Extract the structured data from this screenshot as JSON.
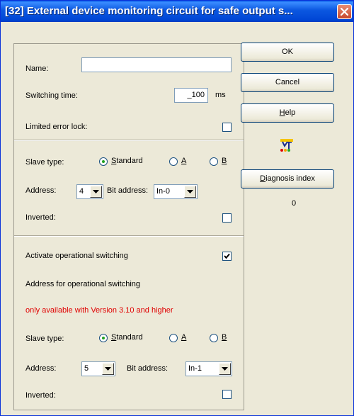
{
  "window": {
    "title": "[32] External device monitoring circuit for safe output s..."
  },
  "fields": {
    "name_label": "Name:",
    "name_value": "",
    "switching_time_label": "Switching time:",
    "switching_time_value": "_100",
    "switching_time_unit": "ms",
    "limited_error_lock_label": "Limited error lock:",
    "limited_error_lock_checked": false
  },
  "slave1": {
    "slave_type_label": "Slave type:",
    "options": [
      "Standard",
      "A",
      "B"
    ],
    "selected": "Standard",
    "address_label": "Address:",
    "address_value": "4",
    "bit_address_label": "Bit address:",
    "bit_address_value": "In-0",
    "inverted_label": "Inverted:",
    "inverted_checked": false
  },
  "operational": {
    "activate_label": "Activate operational switching",
    "activate_checked": true,
    "address_heading": "Address for operational switching",
    "note": "only available with Version 3.10 and higher",
    "note_color": "#e00000"
  },
  "slave2": {
    "slave_type_label": "Slave type:",
    "options": [
      "Standard",
      "A",
      "B"
    ],
    "selected": "Standard",
    "address_label": "Address:",
    "address_value": "5",
    "bit_address_label": "Bit address:",
    "bit_address_value": "In-1",
    "inverted_label": "Inverted:",
    "inverted_checked": false
  },
  "buttons": {
    "ok": "OK",
    "cancel": "Cancel",
    "help": "Help",
    "diagnosis_index": "Diagnosis index"
  },
  "diagnosis_value": "0",
  "icons": {
    "close": "close-icon",
    "circuit": "circuit-diagram-icon"
  },
  "colors": {
    "titlebar": "#0054e3",
    "dialog_bg": "#ece9d8",
    "note_text": "#e00000"
  }
}
